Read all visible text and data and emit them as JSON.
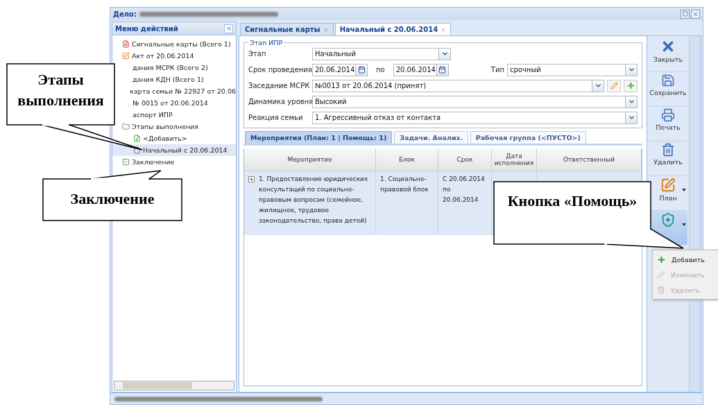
{
  "window": {
    "title": "Дело:"
  },
  "menu": {
    "title": "Меню действий",
    "items": [
      {
        "label": "Сигнальные карты (Всего 1)",
        "kind": "card",
        "selected": false
      },
      {
        "label": "Акт от 20.06.2014",
        "kind": "act",
        "selected": false
      },
      {
        "label": "дания МСРК (Всего 2)",
        "kind": "hidden",
        "selected": false
      },
      {
        "label": "дания КДН (Всего 1)",
        "kind": "hidden",
        "selected": false
      },
      {
        "label": "карта семьи № 22927 от 20.06",
        "kind": "hidden",
        "selected": false
      },
      {
        "label": "№ 0015 от 20.06.2014",
        "kind": "hidden",
        "selected": false
      },
      {
        "label": "аспорт ИПР",
        "kind": "hidden",
        "selected": false
      },
      {
        "label": "Этапы выполнения",
        "kind": "folder",
        "selected": false,
        "children": [
          {
            "label": "<Добавить>",
            "kind": "add",
            "selected": false
          },
          {
            "label": "Начальный с 20.06.2014",
            "kind": "page",
            "selected": true
          }
        ]
      },
      {
        "label": "Заключение",
        "kind": "check",
        "selected": false
      }
    ]
  },
  "tabs": [
    {
      "label": "Сигнальные карты",
      "selected": false
    },
    {
      "label": "Начальный с 20.06.2014",
      "selected": true
    }
  ],
  "form": {
    "legend": "Этап ИПР",
    "stage": {
      "label": "Этап",
      "value": "Начальный"
    },
    "period": {
      "label": "Срок проведения",
      "from": "20.06.2014",
      "to_label": "по",
      "to": "20.06.2014",
      "type_label": "Тип",
      "type": "срочный"
    },
    "meeting": {
      "label": "Заседание МСРК",
      "value": "№0013 от 20.06.2014 (принят)"
    },
    "dynamics": {
      "label": "Динамика уровня",
      "value": "Высокий"
    },
    "reaction": {
      "label": "Реакция семьи",
      "value": "1. Агрессивный отказ от контакта"
    }
  },
  "sub_tabs": [
    {
      "label": "Мероприятия (План: 1 | Помощь: 1)",
      "selected": true
    },
    {
      "label": "Задачи. Анализ.",
      "selected": false
    },
    {
      "label": "Рабочая группа (<ПУСТО>)",
      "selected": false
    }
  ],
  "table": {
    "columns": [
      "Мероприятие",
      "Блок",
      "Срок",
      "Дата исполнения",
      "Ответственный"
    ],
    "rows": [
      {
        "expanded": false,
        "cells": [
          "1. Предоставление юридических консультаций по социально-правовым вопросам (семейное, жилищное, трудовое законодательство, права детей)",
          "1. Социально-правовой блок",
          "С 20.06.2014 по 20.06.2014"
        ]
      }
    ]
  },
  "toolbar": [
    {
      "label": "Закрыть",
      "kind": "close",
      "pressed": false
    },
    {
      "label": "Сохранить",
      "kind": "save",
      "pressed": false
    },
    {
      "label": "Печать",
      "kind": "print",
      "pressed": false
    },
    {
      "label": "Удалить",
      "kind": "delete",
      "pressed": false
    },
    {
      "label": "План",
      "kind": "plan",
      "pressed": false
    },
    {
      "kind": "help",
      "pressed": true
    }
  ],
  "help_menu": [
    {
      "label": "Добавить",
      "kind": "add",
      "disabled": false
    },
    {
      "label": "Изменить",
      "kind": "edit",
      "disabled": true
    },
    {
      "label": "Удалить",
      "kind": "delete",
      "disabled": true
    }
  ],
  "callouts": [
    {
      "text": "Этапы выполнения",
      "kind": "stages"
    },
    {
      "text": "Заключение",
      "kind": "conclusion"
    },
    {
      "text": "Кнопка «Помощь»",
      "kind": "help"
    }
  ]
}
